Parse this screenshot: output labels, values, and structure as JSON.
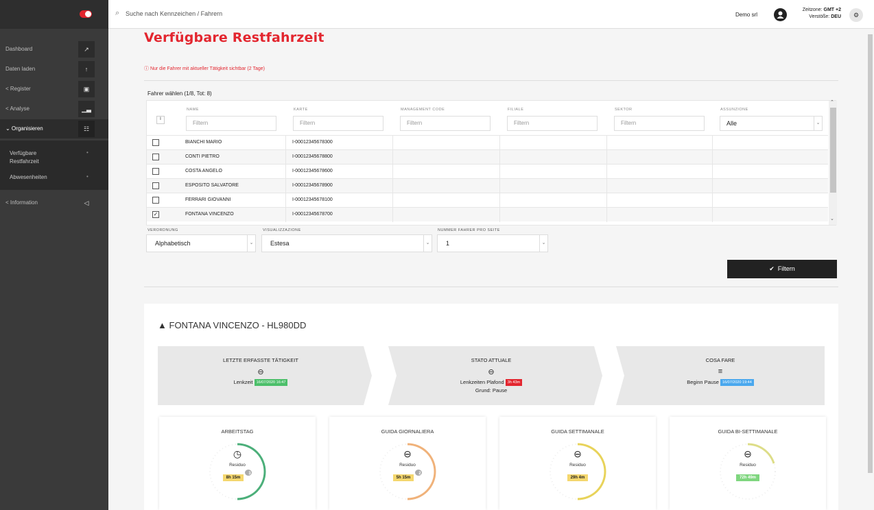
{
  "sidebar": {
    "items": [
      {
        "label": "Dashboard",
        "icon": "chart-line-icon"
      },
      {
        "label": "Daten laden",
        "icon": "upload-icon"
      },
      {
        "label": "< Register",
        "icon": "book-icon"
      },
      {
        "label": "< Analyse",
        "icon": "bar-chart-icon"
      },
      {
        "label": "⌄ Organisieren",
        "icon": "sitemap-icon"
      },
      {
        "label": "< Information",
        "icon": "megaphone-icon"
      }
    ],
    "submenu": [
      {
        "label": "Verfügbare Restfahrzeit"
      },
      {
        "label": "Abwesenheiten"
      }
    ]
  },
  "topbar": {
    "search_placeholder": "Suche nach Kennzeichen / Fahrern",
    "user": "Demo srl",
    "timezone_label": "Zeitzone:",
    "timezone_value": "GMT +2",
    "violations_label": "Verstöße:",
    "violations_value": "DEU"
  },
  "page": {
    "title": "Verfügbare Restfahrzeit",
    "notice": "Nur die Fahrer mit aktueller Tätigkeit sichtbar (2 Tage)"
  },
  "table": {
    "select_label": "Fahrer wählen (1/8, Tot: 8)",
    "columns": [
      "NAME",
      "KARTE",
      "MANAGEMENT CODE",
      "FILIALE",
      "SEKTOR",
      "ASSUNZIONE"
    ],
    "filter_placeholder": "Filtern",
    "assunzione_value": "Alle",
    "rows": [
      {
        "name": "BIANCHI MARIO",
        "card": "I-00012345678300",
        "checked": false
      },
      {
        "name": "CONTI PIETRO",
        "card": "I-00012345678800",
        "checked": false
      },
      {
        "name": "COSTA ANGELO",
        "card": "I-00012345678600",
        "checked": false
      },
      {
        "name": "ESPOSITO SALVATORE",
        "card": "I-00012345678900",
        "checked": false
      },
      {
        "name": "FERRARI GIOVANNI",
        "card": "I-00012345678100",
        "checked": false
      },
      {
        "name": "FONTANA VINCENZO",
        "card": "I-00012345678700",
        "checked": true
      }
    ]
  },
  "controls": {
    "order_label": "VERORDNUNG",
    "order_value": "Alphabetisch",
    "view_label": "VISUALIZZAZIONE",
    "view_value": "Estesa",
    "perpage_label": "NUMMER FAHRER PRO SEITE",
    "perpage_value": "1",
    "filter_button": "Filtern"
  },
  "driver": {
    "title": "FONTANA VINCENZO - HL980DD",
    "stages": [
      {
        "title": "LETZTE ERFASSTE TÄTIGKEIT",
        "line": "Lenkzeit",
        "badge": "16/07/2020 16:47",
        "badge_color": "#4cbf6a",
        "icon": "steering-wheel-icon"
      },
      {
        "title": "STATO ATTUALE",
        "line": "Lenkzeiten Plafond",
        "badge": "3h 43m",
        "badge_color": "#e3262f",
        "line2": "Grund: Pause",
        "icon": "steering-wheel-icon"
      },
      {
        "title": "COSA FARE",
        "line": "Beginn Pause",
        "badge": "16/07/2020 19:44",
        "badge_color": "#4aa8ee",
        "icon": "bed-icon"
      }
    ],
    "gauges": [
      {
        "title": "ARBEITSTAG",
        "resid_label": "Residuo",
        "value": "8h 15m",
        "count": "3",
        "color": "#4caf7a",
        "badge_bg": "#f5d76e",
        "icon": "clock-icon"
      },
      {
        "title": "GUIDA GIORNALIERA",
        "resid_label": "Residuo",
        "value": "5h 15m",
        "count": "2",
        "color": "#f0b27a",
        "badge_bg": "#f5d76e",
        "icon": "steering-wheel-icon"
      },
      {
        "title": "GUIDA SETTIMANALE",
        "resid_label": "Residuo",
        "value": "29h 4m",
        "color": "#e8d35a",
        "badge_bg": "#f5d76e",
        "icon": "steering-wheel-icon"
      },
      {
        "title": "GUIDA BI-SETTIMANALE",
        "resid_label": "Residuo",
        "value": "72h 49m",
        "color": "#dddd88",
        "badge_bg": "#7fd67f",
        "icon": "steering-wheel-icon"
      }
    ]
  }
}
